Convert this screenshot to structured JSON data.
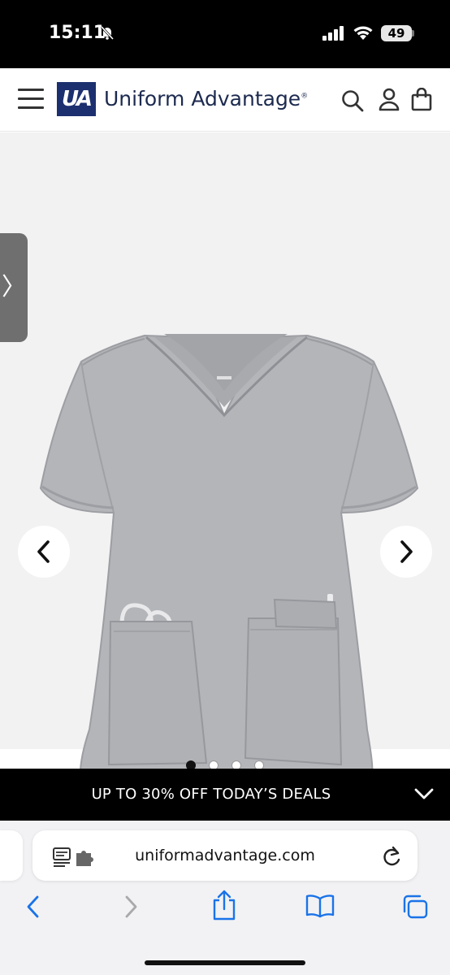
{
  "status_bar": {
    "time": "15:11",
    "battery": "49"
  },
  "header": {
    "logo_mark": "UA",
    "brand": "Uniform Advantage",
    "brand_mark": "®"
  },
  "gallery": {
    "side_tab_glyph": "〉",
    "total_images": 4,
    "active_index": 0
  },
  "promo": {
    "text": "UP TO 30% OFF TODAY’S DEALS"
  },
  "browser": {
    "url": "uniformadvantage.com"
  },
  "colors": {
    "brand_navy": "#1c2f6e",
    "promo_bg": "#000000",
    "ios_blue": "#1a73e8",
    "shirt_gray": "#b4b5b9"
  },
  "icons": [
    "bell-slash-icon",
    "cellular-signal-icon",
    "wifi-icon",
    "battery-icon",
    "hamburger-menu-icon",
    "search-icon",
    "account-icon",
    "shopping-bag-icon",
    "chevron-left-icon",
    "chevron-right-icon",
    "chevron-down-icon",
    "reader-extension-icon",
    "reload-icon",
    "back-icon",
    "forward-icon",
    "share-icon",
    "bookmarks-icon",
    "tabs-icon"
  ]
}
